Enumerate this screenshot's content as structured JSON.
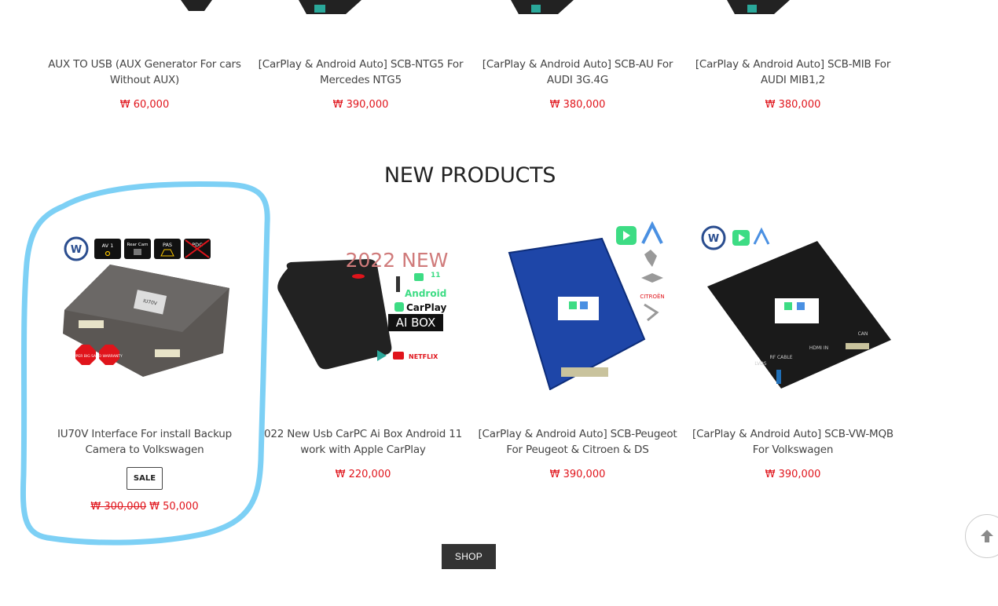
{
  "top_products": [
    {
      "name": "AUX TO USB (AUX Generator For cars Without AUX)",
      "price": "₩ 60,000"
    },
    {
      "name": "[CarPlay & Android Auto] SCB-NTG5 For Mercedes NTG5",
      "price": "₩ 390,000"
    },
    {
      "name": "[CarPlay & Android Auto] SCB-AU For AUDI 3G.4G",
      "price": "₩ 380,000"
    },
    {
      "name": "[CarPlay & Android Auto] SCB-MIB For AUDI MIB1,2",
      "price": "₩ 380,000"
    }
  ],
  "new_products": {
    "title": "NEW PRODUCTS",
    "items": [
      {
        "name": "IU70V Interface For install Backup Camera to Volkswagen",
        "badge": "SALE",
        "price_old": "₩ 300,000",
        "price": "₩ 50,000",
        "image_labels": {
          "av1": "AV 1",
          "rearcam": "Rear Cam",
          "pas": "PAS",
          "pdc": "PDC",
          "sale1": "SUPER BIG SALE",
          "sale2": "NO WARRANTY",
          "device": "IU70V"
        }
      },
      {
        "name": "022 New Usb CarPC Ai Box Android 11 work with Apple CarPlay",
        "price": "₩ 220,000",
        "image_labels": {
          "headline": "2022 NEW",
          "android": "Android",
          "version": "11",
          "carplay": "CarPlay",
          "aibox": "AI BOX",
          "netflix": "NETFLIX"
        }
      },
      {
        "name": "[CarPlay & Android Auto] SCB-Peugeot For Peugeot & Citroen & DS",
        "price": "₩ 390,000",
        "image_labels": {
          "brand": "CITROËN"
        }
      },
      {
        "name": "[CarPlay & Android Auto] SCB-VW-MQB For Volkswagen",
        "price": "₩ 390,000",
        "image_labels": {
          "hdmi": "HDMI IN",
          "lvds": "LVDS",
          "rf": "RF CABLE",
          "can": "CAN"
        }
      }
    ]
  },
  "shop_button": "SHOP",
  "colors": {
    "price": "#e0141b",
    "highlight": "#7dd0f5",
    "button_bg": "#333333"
  },
  "icons": [
    "arrow-up-icon"
  ]
}
